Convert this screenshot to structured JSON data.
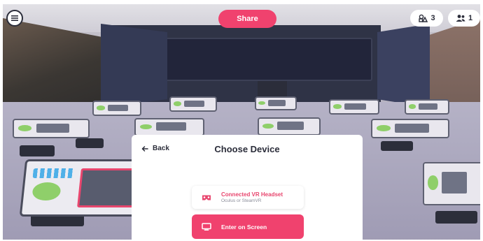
{
  "toolbar": {
    "menu_icon": "hamburger-menu-icon",
    "share_label": "Share",
    "objects_count": "3",
    "objects_icon": "shapes-icon",
    "users_count": "1",
    "users_icon": "users-icon"
  },
  "modal": {
    "back_label": "Back",
    "title": "Choose Device",
    "options": [
      {
        "title": "Connected VR Headset",
        "subtitle": "Oculus or SteamVR",
        "icon": "vr-headset-icon"
      },
      {
        "title": "Enter on Screen",
        "icon": "monitor-icon"
      }
    ]
  },
  "colors": {
    "accent": "#f0426e",
    "text_dark": "#2b2d3a",
    "muted": "#8a8c99"
  }
}
